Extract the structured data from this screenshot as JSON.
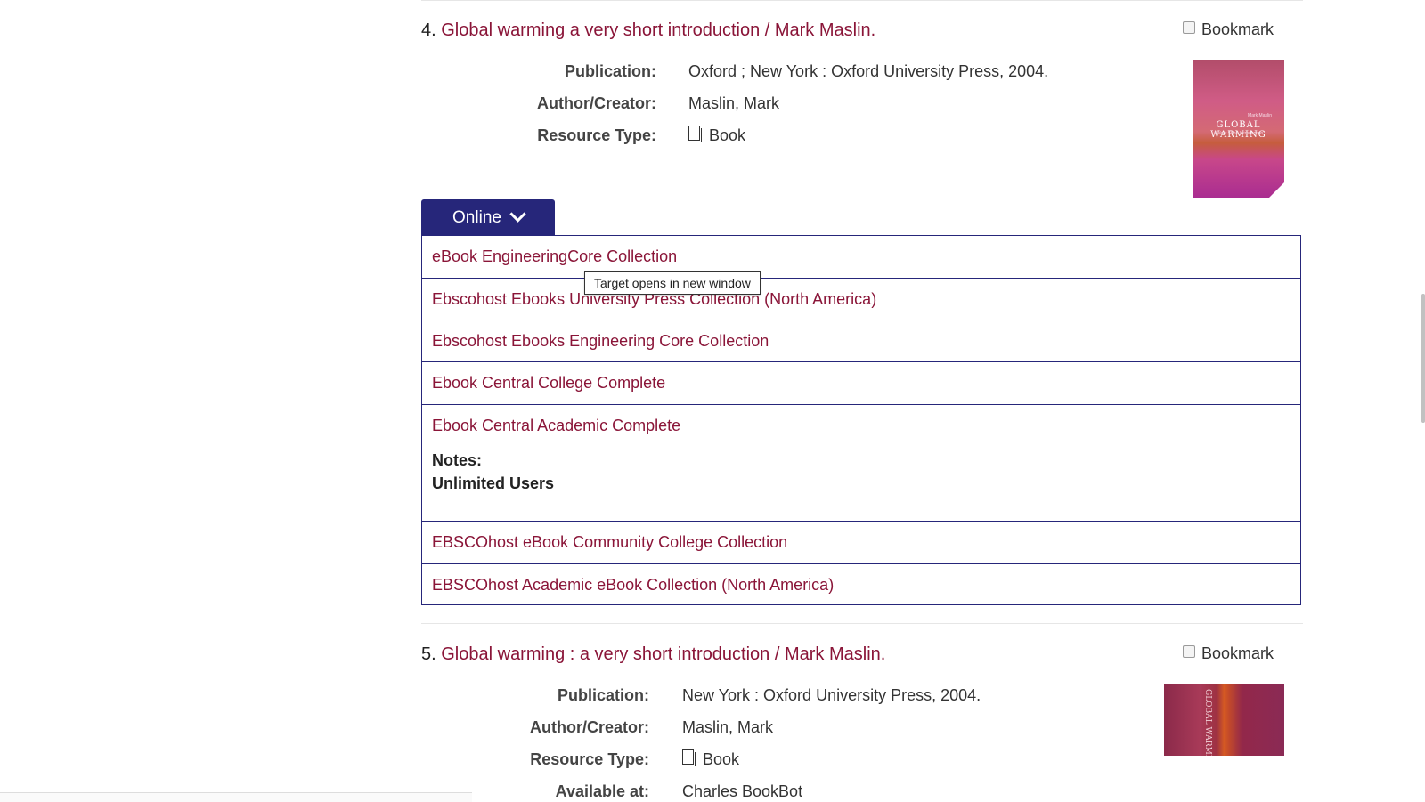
{
  "results": [
    {
      "number": "4.",
      "title": "Global warming a very short introduction / Mark Maslin.",
      "bookmark_label": "Bookmark",
      "fields": {
        "publication_label": "Publication:",
        "publication_value": "Oxford ; New York : Oxford University Press, 2004.",
        "author_label": "Author/Creator:",
        "author_value": "Maslin, Mark",
        "resource_label": "Resource Type:",
        "resource_value": "Book",
        "resource_icon": "book-icon"
      },
      "cover": {
        "title_text": "GLOBAL WARMING",
        "subtitle_text": "A Very Short Introduction",
        "author_text": "Mark Maslin"
      },
      "online": {
        "button_label": "Online",
        "links": [
          "eBook EngineeringCore Collection",
          "Ebscohost Ebooks University Press Collection (North America)",
          "Ebscohost Ebooks Engineering Core Collection",
          "Ebook Central College Complete",
          "Ebook Central Academic Complete",
          "EBSCOhost eBook Community College Collection",
          "EBSCOhost Academic eBook Collection (North America)"
        ],
        "notes_label": "Notes:",
        "notes_value": "Unlimited Users"
      }
    },
    {
      "number": "5.",
      "title": "Global warming : a very short introduction / Mark Maslin.",
      "bookmark_label": "Bookmark",
      "fields": {
        "publication_label": "Publication:",
        "publication_value": "New York : Oxford University Press, 2004.",
        "author_label": "Author/Creator:",
        "author_value": "Maslin, Mark",
        "resource_label": "Resource Type:",
        "resource_value": "Book",
        "resource_icon": "book-icon",
        "available_label": "Available at:",
        "available_value": "Charles BookBot"
      },
      "cover": {
        "title_text": "GLOBAL WARMING"
      }
    }
  ],
  "tooltip": "Target opens in new window",
  "colors": {
    "link": "#8a1538",
    "online_button": "#26267a"
  }
}
